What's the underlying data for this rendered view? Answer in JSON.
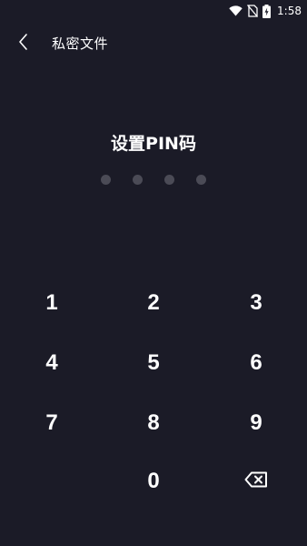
{
  "status_bar": {
    "time": "1:58",
    "icons": [
      "wifi-icon",
      "no-sim-icon",
      "battery-charging-icon"
    ]
  },
  "header": {
    "back_icon": "chevron-left-icon",
    "title": "私密文件"
  },
  "pin": {
    "title": "设置PIN码",
    "length": 4,
    "entered": 0,
    "dot_color": "#4b4b56"
  },
  "keypad": {
    "keys": [
      "1",
      "2",
      "3",
      "4",
      "5",
      "6",
      "7",
      "8",
      "9",
      "",
      "0",
      "backspace"
    ],
    "backspace_icon": "backspace-icon"
  },
  "colors": {
    "background": "#1b1b27",
    "text": "#ffffff"
  }
}
